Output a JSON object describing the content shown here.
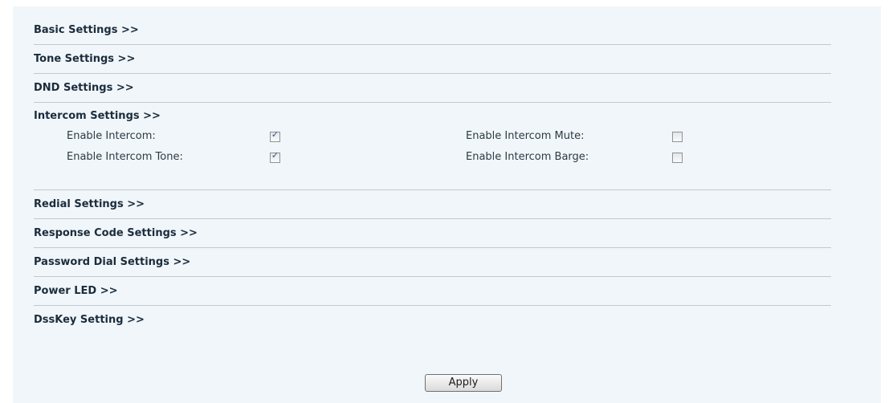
{
  "sections": [
    {
      "label": "Basic Settings >>"
    },
    {
      "label": "Tone Settings >>"
    },
    {
      "label": "DND Settings >>"
    },
    {
      "label": "Intercom Settings >>"
    },
    {
      "label": "Redial Settings >>"
    },
    {
      "label": "Response Code Settings >>"
    },
    {
      "label": "Password Dial Settings >>"
    },
    {
      "label": "Power LED >>"
    },
    {
      "label": "DssKey Setting >>"
    }
  ],
  "intercom": {
    "enable_intercom": {
      "label": "Enable Intercom:",
      "checked": true
    },
    "enable_intercom_tone": {
      "label": "Enable Intercom Tone:",
      "checked": true
    },
    "enable_intercom_mute": {
      "label": "Enable Intercom Mute:",
      "checked": false
    },
    "enable_intercom_barge": {
      "label": "Enable Intercom Barge:",
      "checked": false
    }
  },
  "checkmark_glyph": "✓",
  "apply_label": "Apply"
}
